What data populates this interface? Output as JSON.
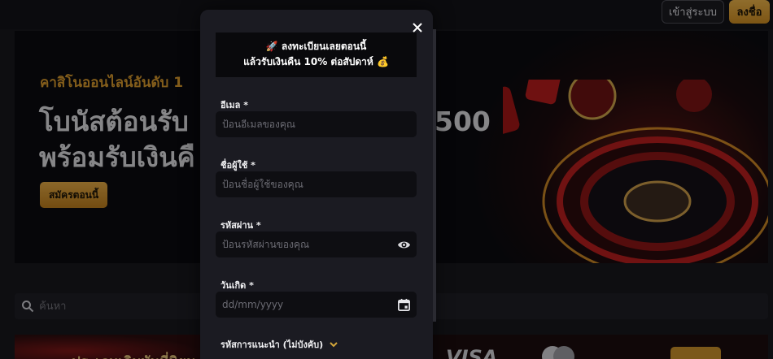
{
  "header": {
    "login_label": "เข้าสู่ระบบ",
    "register_label": "ลงชื่อ"
  },
  "hero": {
    "tag": "คาสิโนออนไลน์อันดับ 1",
    "title_line1": "โบนัสต้อนรับ",
    "title_500": "500",
    "title_line2": "พร้อมรับเงินคื",
    "cta_label": "สมัครตอนนี้"
  },
  "search": {
    "placeholder": "ค้นหา"
  },
  "modal": {
    "banner_line1": "🚀 ลงทะเบียนเลยตอนนี้",
    "banner_line2": "แล้วรับเงินคืน 10% ต่อสัปดาห์ 💰",
    "fields": [
      {
        "label": "อีเมล *",
        "placeholder": "ป้อนอีเมลของคุณ"
      },
      {
        "label": "ชื่อผู้ใช้ *",
        "placeholder": "ป้อนชื่อผู้ใช้ของคุณ"
      },
      {
        "label": "รหัสผ่าน *",
        "placeholder": "ป้อนรหัสผ่านของคุณ"
      },
      {
        "label": "วันเกิด *",
        "placeholder": "dd/mm/yyyy"
      }
    ],
    "referral_label": "รหัสการแนะนำ (ไม่บังคับ)"
  },
  "promo": {
    "text": "ประเภทเดิมพันที่นิยม",
    "card_brand": "VISA"
  },
  "colors": {
    "accent": "#d3962c",
    "modal_bg": "#1b1b22",
    "field_bg": "#0e0e12"
  },
  "icons": {
    "close": "close-icon",
    "eye": "eye-icon",
    "calendar": "calendar-icon",
    "search": "search-icon",
    "chevron": "chevron-down-icon"
  }
}
